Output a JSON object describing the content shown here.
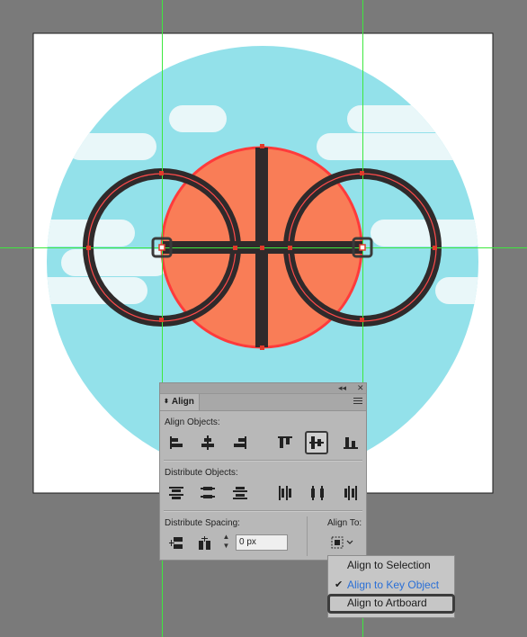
{
  "colors": {
    "workspace": "#7a7a7a",
    "artboard": "#ffffff",
    "sky_circle": "#93e1ea",
    "cloud": "#e9f7f9",
    "ball": "#f97d57",
    "ball_outline": "#ff3b3b",
    "dark": "#2f2a2b",
    "guide": "#3ee83e",
    "anchor": "#e23a2a"
  },
  "panel": {
    "tab_label": "Align",
    "align_objects_label": "Align Objects:",
    "distribute_objects_label": "Distribute Objects:",
    "distribute_spacing_label": "Distribute Spacing:",
    "align_to_label": "Align To:",
    "spacing_value": "0 px",
    "collapse_glyph": "◂◂",
    "close_glyph": "✕"
  },
  "dropdown": {
    "items": [
      {
        "label": "Align to Selection",
        "checked": false
      },
      {
        "label": "Align to Key Object",
        "checked": true
      },
      {
        "label": "Align to Artboard",
        "checked": false
      }
    ],
    "check_glyph": "✔"
  }
}
